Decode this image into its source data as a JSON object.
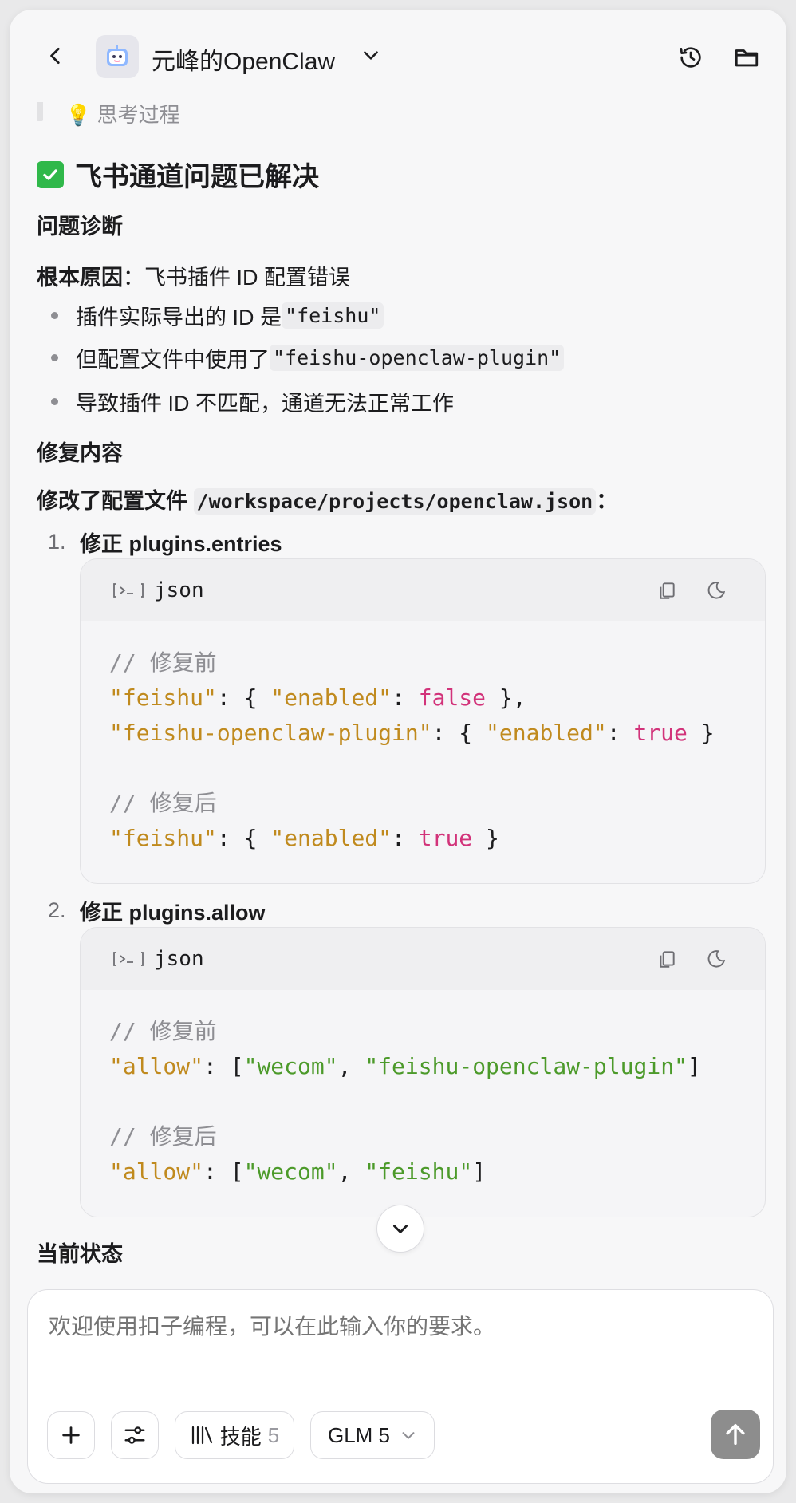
{
  "header": {
    "title": "元峰的OpenClaw",
    "back_icon": "chevron-left-icon",
    "history_icon": "history-icon",
    "folder_icon": "folder-icon"
  },
  "message": {
    "thinking_label": "思考过程",
    "heading": "飞书通道问题已解决",
    "diagnosis_heading": "问题诊断",
    "root_cause_label": "根本原因",
    "root_cause_text": "：飞书插件 ID 配置错误",
    "bullets": [
      {
        "prefix": "插件实际导出的 ID 是 ",
        "code": "\"feishu\"",
        "suffix": ""
      },
      {
        "prefix": "但配置文件中使用了 ",
        "code": "\"feishu-openclaw-plugin\"",
        "suffix": ""
      },
      {
        "prefix": "导致插件 ID 不匹配，通道无法正常工作",
        "code": "",
        "suffix": ""
      }
    ],
    "fix_heading": "修复内容",
    "fix_intro_prefix": "修改了配置文件 ",
    "fix_intro_code": "/workspace/projects/openclaw.json",
    "fix_intro_suffix": "：",
    "steps": [
      {
        "num": "1.",
        "label": "修正 plugins.entries"
      },
      {
        "num": "2.",
        "label": "修正 plugins.allow"
      }
    ],
    "code_lang": "json",
    "code1": {
      "before_comment": "// 修复前",
      "after_comment": "// 修复后",
      "line1_key": "\"feishu\"",
      "line1_mid": ": { ",
      "line1_k2": "\"enabled\"",
      "line1_colon": ": ",
      "line1_val": "false",
      "line1_end": " },",
      "line2_key": "\"feishu-openclaw-plugin\"",
      "line2_mid": ": { ",
      "line2_k2": "\"enabled\"",
      "line2_colon": ": ",
      "line2_val": "true",
      "line2_end": " }",
      "line3_key": "\"feishu\"",
      "line3_mid": ": { ",
      "line3_k2": "\"enabled\"",
      "line3_colon": ": ",
      "line3_val": "true",
      "line3_end": " }"
    },
    "code2": {
      "before_comment": "// 修复前",
      "after_comment": "// 修复后",
      "line1_key": "\"allow\"",
      "line1_mid": ": [",
      "line1_s1": "\"wecom\"",
      "line1_sep": ", ",
      "line1_s2": "\"feishu-openclaw-plugin\"",
      "line1_end": "]",
      "line2_key": "\"allow\"",
      "line2_mid": ": [",
      "line2_s1": "\"wecom\"",
      "line2_sep": ", ",
      "line2_s2": "\"feishu\"",
      "line2_end": "]"
    },
    "status_heading": "当前状态"
  },
  "composer": {
    "placeholder": "欢迎使用扣子编程，可以在此输入你的要求。",
    "skills_label": "技能",
    "skills_count": "5",
    "model_label": "GLM 5"
  },
  "colors": {
    "accent_green": "#30b84a",
    "code_key": "#c08a1e",
    "code_bool": "#d2337a",
    "code_string": "#4c9a2a",
    "send_button": "#8d8d8d"
  }
}
